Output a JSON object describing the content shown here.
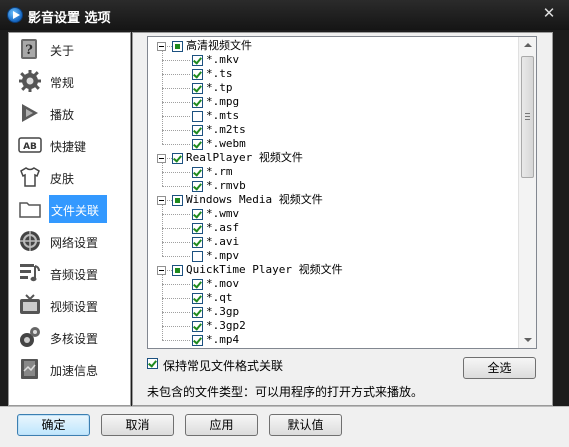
{
  "window": {
    "title": "影音设置 选项",
    "close_icon": "close-icon"
  },
  "sidebar": {
    "items": [
      {
        "label": "关于",
        "icon": "about-icon"
      },
      {
        "label": "常规",
        "icon": "gear-icon"
      },
      {
        "label": "播放",
        "icon": "play-icon"
      },
      {
        "label": "快捷键",
        "icon": "keyboard-icon"
      },
      {
        "label": "皮肤",
        "icon": "tshirt-icon"
      },
      {
        "label": "文件关联",
        "icon": "folder-icon",
        "active": true
      },
      {
        "label": "网络设置",
        "icon": "network-icon"
      },
      {
        "label": "音频设置",
        "icon": "audio-icon"
      },
      {
        "label": "视频设置",
        "icon": "tv-icon"
      },
      {
        "label": "多核设置",
        "icon": "cores-icon"
      },
      {
        "label": "加速信息",
        "icon": "info-icon"
      }
    ],
    "active_color": "#3399ff"
  },
  "tree": {
    "groups": [
      {
        "label": "高清视频文件",
        "state": "partial",
        "items": [
          {
            "label": "*.mkv",
            "checked": true
          },
          {
            "label": "*.ts",
            "checked": true
          },
          {
            "label": "*.tp",
            "checked": true
          },
          {
            "label": "*.mpg",
            "checked": true
          },
          {
            "label": "*.mts",
            "checked": false
          },
          {
            "label": "*.m2ts",
            "checked": true
          },
          {
            "label": "*.webm",
            "checked": true
          }
        ]
      },
      {
        "label": "RealPlayer 视频文件",
        "state": "checked",
        "items": [
          {
            "label": "*.rm",
            "checked": true
          },
          {
            "label": "*.rmvb",
            "checked": true
          }
        ]
      },
      {
        "label": "Windows Media 视频文件",
        "state": "partial",
        "items": [
          {
            "label": "*.wmv",
            "checked": true
          },
          {
            "label": "*.asf",
            "checked": true
          },
          {
            "label": "*.avi",
            "checked": true
          },
          {
            "label": "*.mpv",
            "checked": false
          }
        ]
      },
      {
        "label": "QuickTime Player 视频文件",
        "state": "partial",
        "items": [
          {
            "label": "*.mov",
            "checked": true
          },
          {
            "label": "*.qt",
            "checked": true
          },
          {
            "label": "*.3gp",
            "checked": true
          },
          {
            "label": "*.3gp2",
            "checked": true
          },
          {
            "label": "*.mp4",
            "checked": true
          }
        ]
      }
    ]
  },
  "options": {
    "keep_common_label": "保持常见文件格式关联",
    "keep_common_checked": true,
    "select_all_label": "全选",
    "note": "未包含的文件类型：可以用程序的打开方式来播放。"
  },
  "buttons": {
    "ok": "确定",
    "cancel": "取消",
    "apply": "应用",
    "defaults": "默认值"
  }
}
